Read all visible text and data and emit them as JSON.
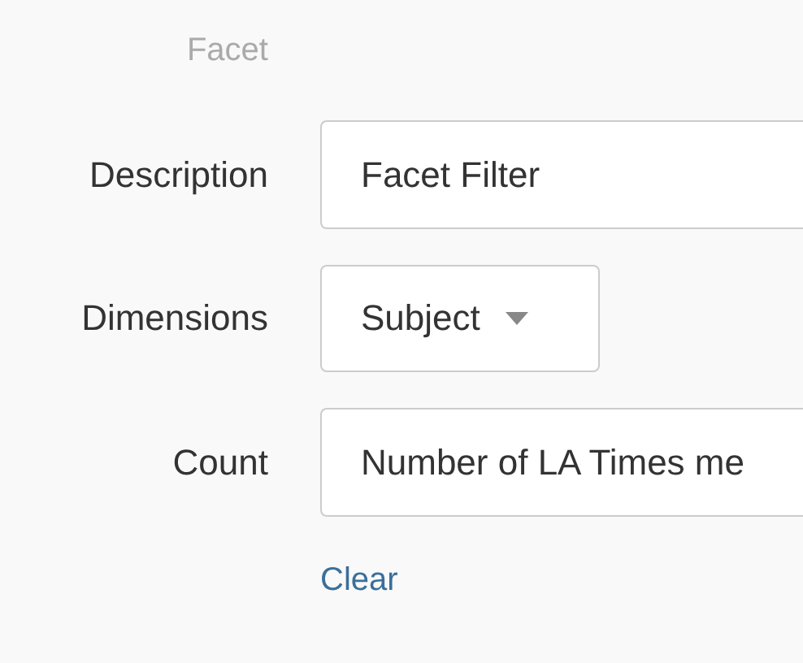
{
  "heading": "Facet",
  "fields": [
    {
      "kind": "text",
      "label": "Description",
      "value": "Facet Filter"
    },
    {
      "kind": "select",
      "label": "Dimensions",
      "value": "Subject"
    },
    {
      "kind": "text",
      "label": "Count",
      "value": "Number of LA Times me"
    }
  ],
  "clear_link": "Clear"
}
